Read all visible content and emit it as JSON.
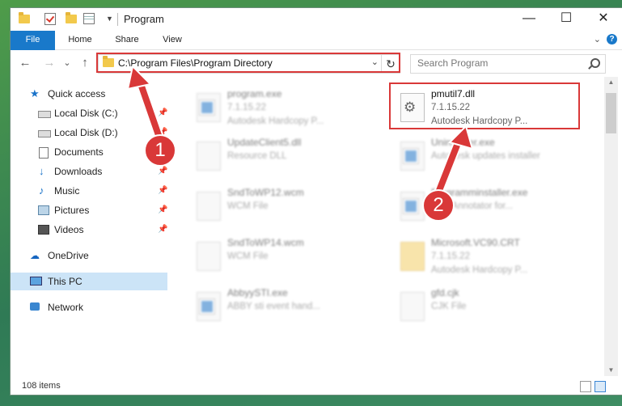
{
  "window": {
    "title": "Program",
    "controls": {
      "minimize": "—",
      "maximize": "☐",
      "close": "✕"
    },
    "qa_dropdown": "▼"
  },
  "ribbon": {
    "tabs": [
      "File",
      "Home",
      "Share",
      "View"
    ],
    "collapse": "⌄",
    "help": "?"
  },
  "nav": {
    "back": "←",
    "forward": "→",
    "recent": "⌄",
    "up": "↑",
    "address": "C:\\Program Files\\Program Directory",
    "address_dropdown": "⌄",
    "refresh": "↻",
    "search_placeholder": "Search Program"
  },
  "sidebar": {
    "items": [
      {
        "label": "Quick access",
        "icon": "star-icon",
        "pinned": false
      },
      {
        "label": "Local Disk (C:)",
        "icon": "drive-icon",
        "pinned": true
      },
      {
        "label": "Local Disk (D:)",
        "icon": "drive-icon",
        "pinned": true
      },
      {
        "label": "Documents",
        "icon": "documents-icon",
        "pinned": true
      },
      {
        "label": "Downloads",
        "icon": "download-icon",
        "pinned": true
      },
      {
        "label": "Music",
        "icon": "music-icon",
        "pinned": true
      },
      {
        "label": "Pictures",
        "icon": "pictures-icon",
        "pinned": true
      },
      {
        "label": "Videos",
        "icon": "videos-icon",
        "pinned": true
      },
      {
        "label": "OneDrive",
        "icon": "cloud-icon",
        "pinned": false
      },
      {
        "label": "This PC",
        "icon": "computer-icon",
        "pinned": false,
        "selected": true
      },
      {
        "label": "Network",
        "icon": "network-icon",
        "pinned": false
      }
    ],
    "pin_glyph": "📌"
  },
  "files": [
    {
      "name": "program.exe",
      "version": "7.1.15.22",
      "description": "Autodesk Hardcopy P...",
      "icon": "exe-icon",
      "blurred": true
    },
    {
      "name": "pmutil7.dll",
      "version": "7.1.15.22",
      "description": "Autodesk Hardcopy P...",
      "icon": "gear-file-icon",
      "blurred": false,
      "highlighted": true
    },
    {
      "name": "UpdateClient5.dll",
      "version": "Resource DLL",
      "description": "",
      "icon": "dll-icon",
      "blurred": true
    },
    {
      "name": "Uninstaller.exe",
      "version": "Autodesk updates installer",
      "description": "",
      "icon": "exe-icon",
      "blurred": true
    },
    {
      "name": "SndToWP12.wcm",
      "version": "WCM File",
      "description": "",
      "icon": "file-icon",
      "blurred": true
    },
    {
      "name": "Programminstaller.exe",
      "version": "PDF Annotator for...",
      "description": "",
      "icon": "exe-icon",
      "blurred": true
    },
    {
      "name": "SndToWP14.wcm",
      "version": "WCM File",
      "description": "",
      "icon": "file-icon",
      "blurred": true
    },
    {
      "name": "Microsoft.VC90.CRT",
      "version": "7.1.15.22",
      "description": "Autodesk Hardcopy P...",
      "icon": "folder-icon",
      "blurred": true
    },
    {
      "name": "AbbyySTI.exe",
      "version": "ABBY sti event hand...",
      "description": "",
      "icon": "exe-icon",
      "blurred": true
    },
    {
      "name": "gfd.cjk",
      "version": "CJK File",
      "description": "",
      "icon": "file-icon",
      "blurred": true
    }
  ],
  "status": {
    "item_count": "108 items"
  },
  "callouts": {
    "one": "1",
    "two": "2"
  },
  "colors": {
    "accent": "#1979ca",
    "highlight": "#d93838",
    "selected": "#cce4f7"
  }
}
